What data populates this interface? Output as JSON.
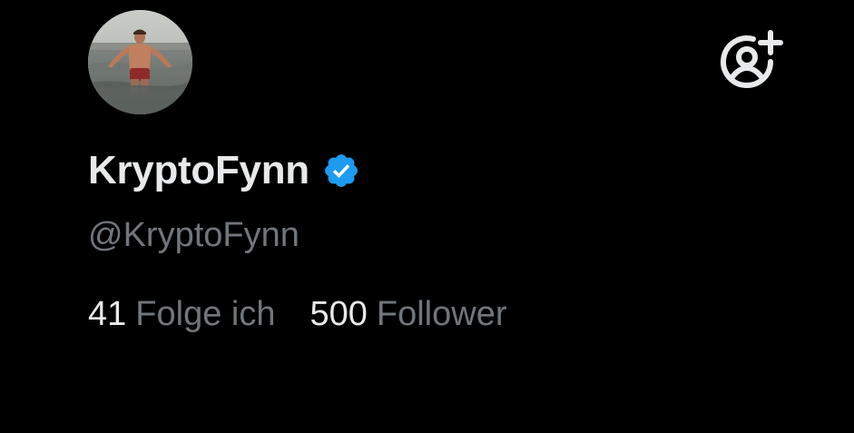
{
  "profile": {
    "display_name": "KryptoFynn",
    "handle": "@KryptoFynn",
    "verified": true,
    "avatar": "avatar-photo"
  },
  "header": {
    "follow_icon": "add-user-icon"
  },
  "stats": {
    "following_count": "41",
    "following_label": "Folge ich",
    "followers_count": "500",
    "followers_label": "Follower"
  },
  "colors": {
    "background": "#000000",
    "text_primary": "#e7e9ea",
    "text_secondary": "#71767b",
    "verified_blue": "#1d9bf0"
  }
}
